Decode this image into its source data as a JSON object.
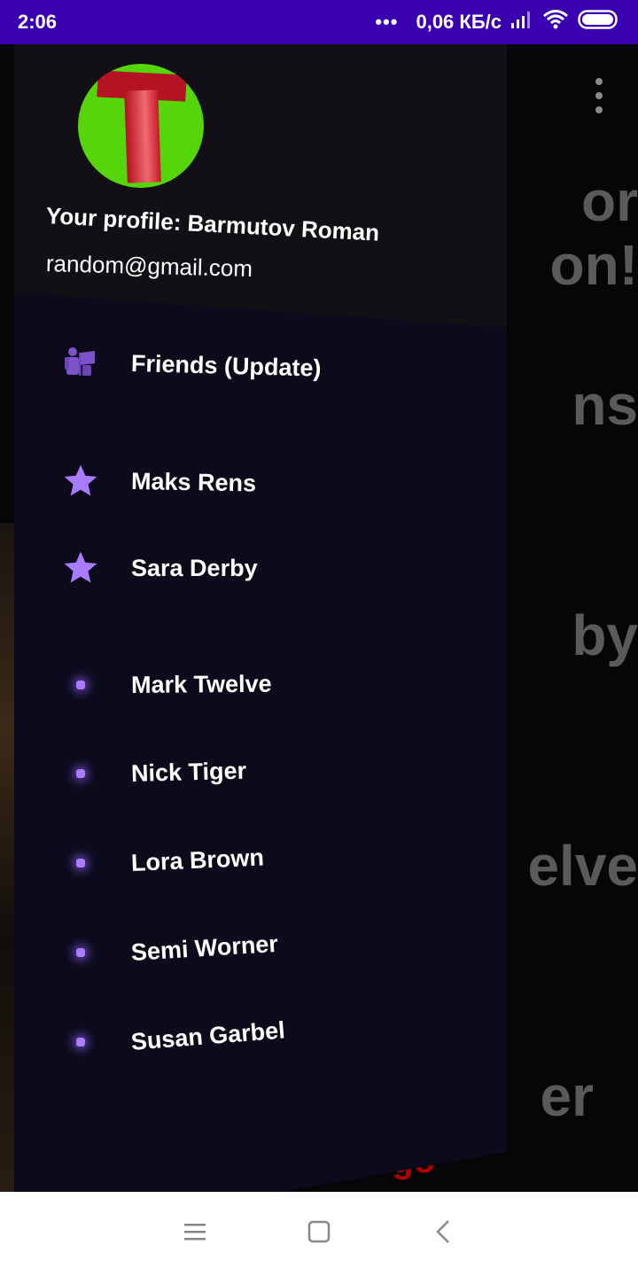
{
  "status_bar": {
    "time": "2:06",
    "dots": "•••",
    "network_speed": "0,06 КБ/с"
  },
  "background": {
    "lines": [
      "or",
      "on!",
      "ns",
      "by",
      "elve",
      "er"
    ],
    "red_text": "ago"
  },
  "drawer": {
    "profile_name": "Your profile: Barmutov Roman",
    "profile_email": "random@gmail.com",
    "friends_label": "Friends (Update)",
    "favorites": [
      {
        "name": "Maks Rens"
      },
      {
        "name": "Sara Derby"
      }
    ],
    "contacts": [
      {
        "name": "Mark Twelve"
      },
      {
        "name": "Nick Tiger"
      },
      {
        "name": "Lora Brown"
      },
      {
        "name": "Semi Worner"
      },
      {
        "name": "Susan Garbel"
      }
    ]
  },
  "colors": {
    "status_bar": "#3a00b0",
    "drawer_bg": "#0c0b1c",
    "accent": "#a97cff",
    "avatar_bg": "#55d60a",
    "avatar_letter": "#b31322"
  },
  "icons": {
    "friends": "friends-icon",
    "favorite": "star-icon",
    "contact": "dot-icon"
  }
}
